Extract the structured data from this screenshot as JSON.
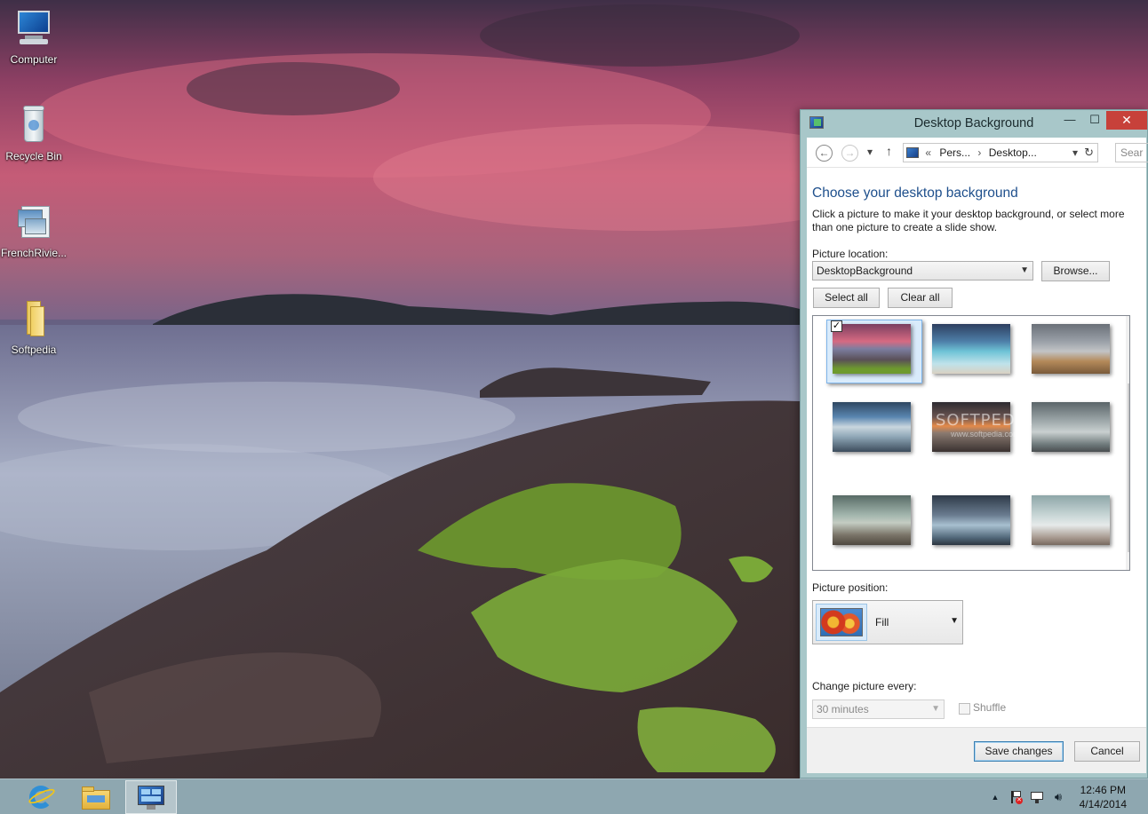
{
  "desktop": {
    "icons": [
      {
        "label": "Computer",
        "icon": "computer-icon"
      },
      {
        "label": "Recycle Bin",
        "icon": "recycle-bin-icon"
      },
      {
        "label": "FrenchRivie...",
        "icon": "theme-file-icon"
      },
      {
        "label": "Softpedia",
        "icon": "folder-icon"
      }
    ]
  },
  "window": {
    "title": "Desktop Background",
    "caption": {
      "minimize": "—",
      "maximize": "☐",
      "close": "✕"
    },
    "nav": {
      "back": "←",
      "forward": "→",
      "dropdown": "▾",
      "up": "↑",
      "breadcrumb": [
        "«",
        "Pers...",
        "›",
        "Desktop..."
      ],
      "refresh": "↻",
      "search_placeholder": "Sear"
    },
    "heading": "Choose your desktop background",
    "description": "Click a picture to make it your desktop background, or select more than one picture to create a slide show.",
    "picture_location": {
      "label": "Picture location:",
      "value": "DesktopBackground",
      "browse": "Browse..."
    },
    "select_all": "Select all",
    "clear_all": "Clear all",
    "gallery": {
      "watermark": "SOFTPEDIA",
      "watermark_sub": "www.softpedia.com",
      "selected_index": 0,
      "scroll_up": "▲",
      "scroll_down": "▼"
    },
    "picture_position": {
      "label": "Picture position:",
      "value": "Fill"
    },
    "change_every": {
      "label": "Change picture every:",
      "value": "30 minutes",
      "shuffle": "Shuffle"
    },
    "save": "Save changes",
    "cancel": "Cancel"
  },
  "taskbar": {
    "apps": [
      "internet-explorer-icon",
      "file-explorer-icon",
      "control-panel-icon"
    ],
    "tray": {
      "show_hidden": "▲"
    },
    "time": "12:46 PM",
    "date": "4/14/2014"
  }
}
